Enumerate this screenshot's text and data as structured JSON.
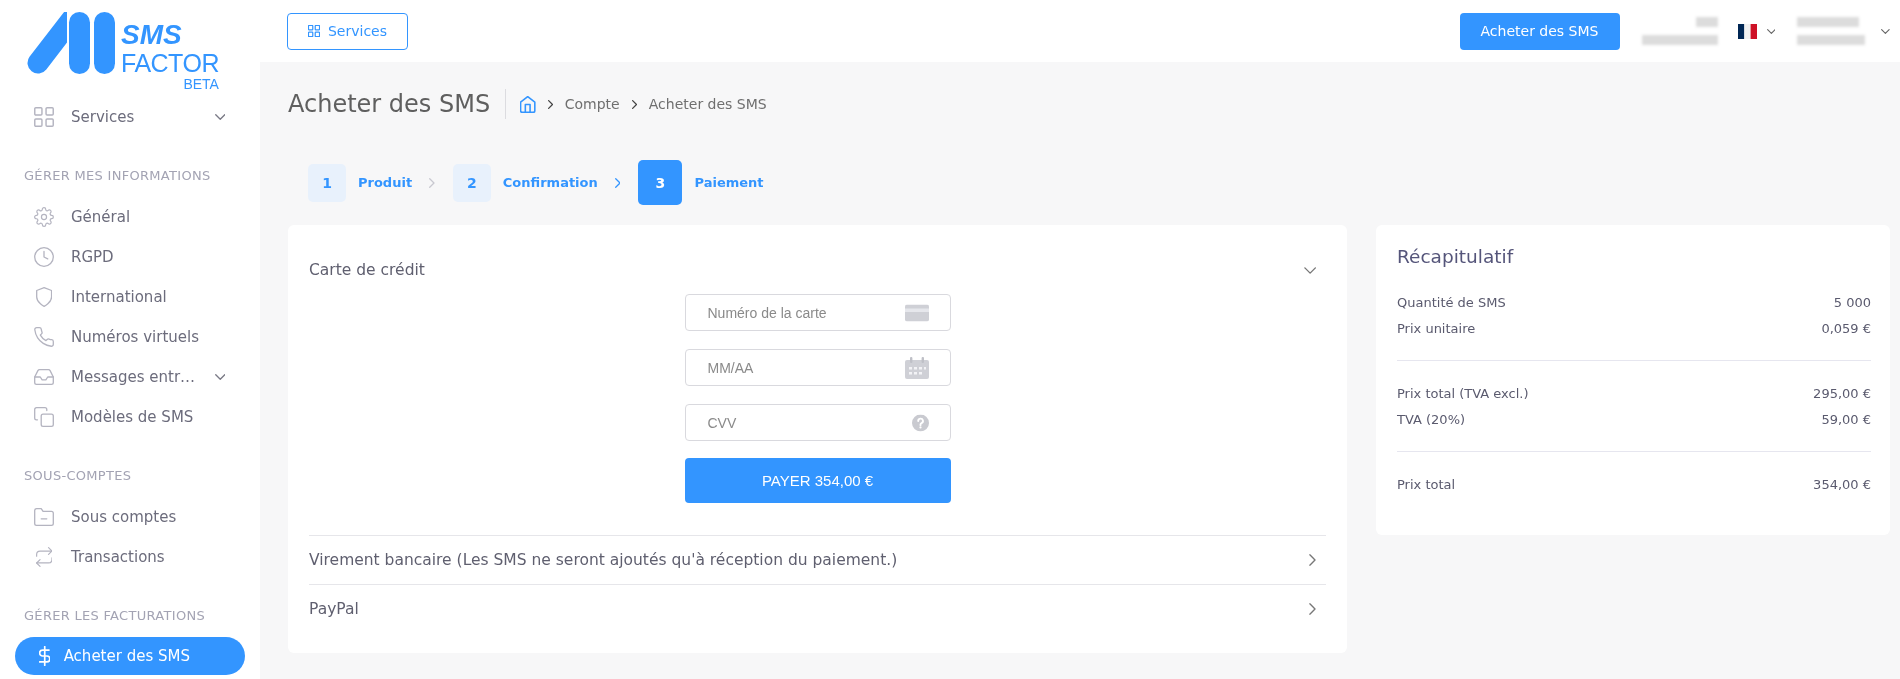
{
  "logo": {
    "name_top": "SMS",
    "name_bottom": "FACTOR",
    "badge": "BETA"
  },
  "sidebar": {
    "groups": [
      {
        "items": [
          {
            "label": "Services",
            "expandable": true,
            "selected": false
          }
        ]
      },
      {
        "title": "GÉRER MES INFORMATIONS",
        "items": [
          {
            "label": "Général",
            "expandable": false,
            "selected": false
          },
          {
            "label": "RGPD",
            "expandable": false,
            "selected": false
          },
          {
            "label": "International",
            "expandable": false,
            "selected": false
          },
          {
            "label": "Numéros virtuels",
            "expandable": false,
            "selected": false
          },
          {
            "label": "Messages entr…",
            "expandable": true,
            "selected": false
          },
          {
            "label": "Modèles de SMS",
            "expandable": false,
            "selected": false
          }
        ]
      },
      {
        "title": "SOUS-COMPTES",
        "items": [
          {
            "label": "Sous comptes",
            "expandable": false,
            "selected": false
          },
          {
            "label": "Transactions",
            "expandable": false,
            "selected": false
          }
        ]
      },
      {
        "title": "GÉRER LES FACTURATIONS"
      }
    ],
    "cta_button": "Acheter des SMS"
  },
  "topbar": {
    "services_button": "Services",
    "buy_button": "Acheter des SMS"
  },
  "page_header": {
    "title": "Acheter des SMS",
    "breadcrumb": [
      "Compte",
      "Acheter des SMS"
    ]
  },
  "steps": [
    {
      "number": "1",
      "label": "Produit",
      "selected": false
    },
    {
      "number": "2",
      "label": "Confirmation",
      "selected": false
    },
    {
      "number": "3",
      "label": "Paiement",
      "selected": true
    }
  ],
  "payment_methods": [
    {
      "label": "Carte de crédit",
      "expanded": true,
      "fields": [
        {
          "placeholder": "Numéro de la carte"
        },
        {
          "placeholder": "MM/AA"
        },
        {
          "placeholder": "CVV"
        }
      ],
      "pay_button": "PAYER 354,00 €"
    },
    {
      "label": "Virement bancaire (Les SMS ne seront ajoutés qu'à réception du paiement.)",
      "expanded": false
    },
    {
      "label": "PayPal",
      "expanded": false
    }
  ],
  "summary": {
    "title": "Récapitulatif",
    "groups": [
      {
        "rows": [
          {
            "label": "Quantité de SMS",
            "value": "5 000"
          },
          {
            "label": "Prix unitaire",
            "value": "0,059 €"
          }
        ]
      },
      {
        "rows": [
          {
            "label": "Prix total (TVA excl.)",
            "value": "295,00 €"
          },
          {
            "label": "TVA (20%)",
            "value": "59,00 €"
          }
        ]
      },
      {
        "rows": [
          {
            "label": "Prix total",
            "value": "354,00 €"
          }
        ]
      }
    ]
  }
}
